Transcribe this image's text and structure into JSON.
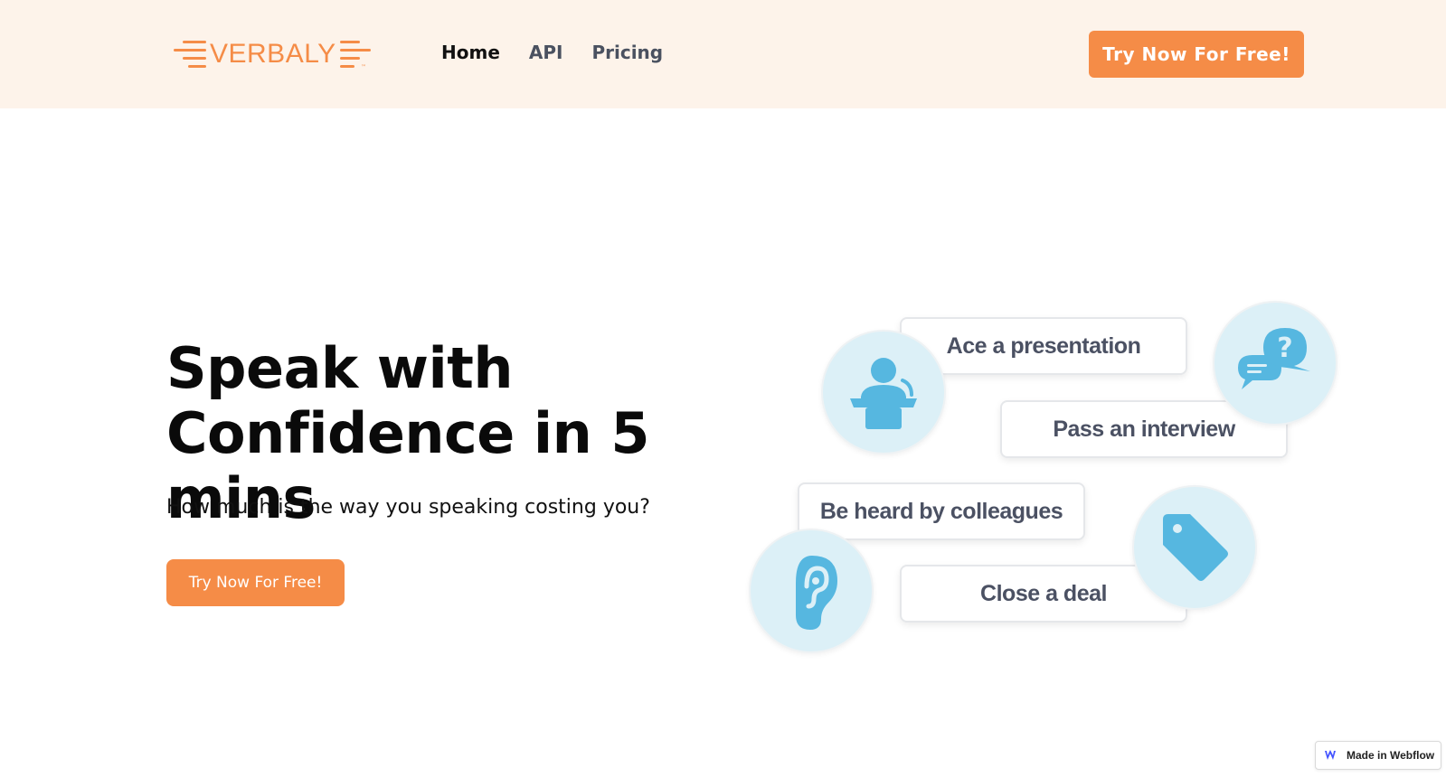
{
  "brand": {
    "logo_text": "VERBALY",
    "trademark": "™",
    "accent_color": "#f58c47"
  },
  "nav": {
    "items": [
      {
        "label": "Home",
        "active": true
      },
      {
        "label": "API",
        "active": false
      },
      {
        "label": "Pricing",
        "active": false
      }
    ],
    "cta_label": "Try Now For Free!"
  },
  "hero": {
    "title_line1": "Speak with",
    "title_line2": "Confidence in 5 mins",
    "subtitle": "How much is the way you speaking costing you?",
    "cta_label": "Try Now For Free!"
  },
  "illustration": {
    "cards": [
      "Ace a presentation",
      "Pass an interview",
      "Be heard by colleagues",
      "Close a deal"
    ],
    "icons": [
      "presenter-icon",
      "question-chat-icon",
      "ear-icon",
      "price-tag-icon"
    ],
    "icon_color": "#56b7e0",
    "circle_color": "#dcf0f7"
  },
  "badge": {
    "label": "Made in Webflow",
    "icon": "webflow-icon"
  }
}
